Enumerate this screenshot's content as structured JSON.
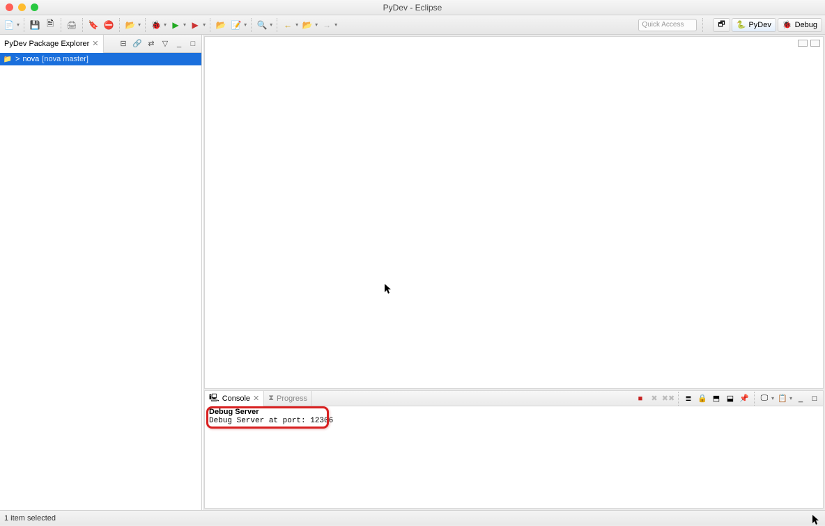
{
  "window": {
    "title": "PyDev - Eclipse"
  },
  "quick_access": {
    "placeholder": "Quick Access"
  },
  "perspectives": {
    "pydev": "PyDev",
    "debug": "Debug"
  },
  "sidebar": {
    "title": "PyDev Package Explorer",
    "item_prefix": ">",
    "item_name": "nova",
    "item_deco": "[nova master]"
  },
  "tabs": {
    "console": "Console",
    "progress": "Progress"
  },
  "console": {
    "header": "Debug Server",
    "output": "Debug Server at port: 12306"
  },
  "status": {
    "text": "1 item selected"
  },
  "icons": {
    "new": "📄",
    "save": "💾",
    "saveall": "🗎",
    "print": "🖨",
    "break": "🔖",
    "skip": "⛔",
    "folder": "📂",
    "wiz": "✨",
    "run": "▶",
    "stop": "■",
    "extlaunch": "⚙",
    "search": "🔍",
    "task": "📝",
    "back": "←",
    "fwd": "→",
    "up": "↑",
    "collapse": "⊟",
    "link": "🔗",
    "filter": "⋮",
    "menu": "▽",
    "min": "_",
    "max": "□",
    "close": "✕",
    "terminate": "■",
    "remove": "✖",
    "removeall": "✖✖",
    "clear": "≣",
    "scroll": "🔒",
    "pin": "📌",
    "display": "🖵",
    "newcon": "📋"
  }
}
